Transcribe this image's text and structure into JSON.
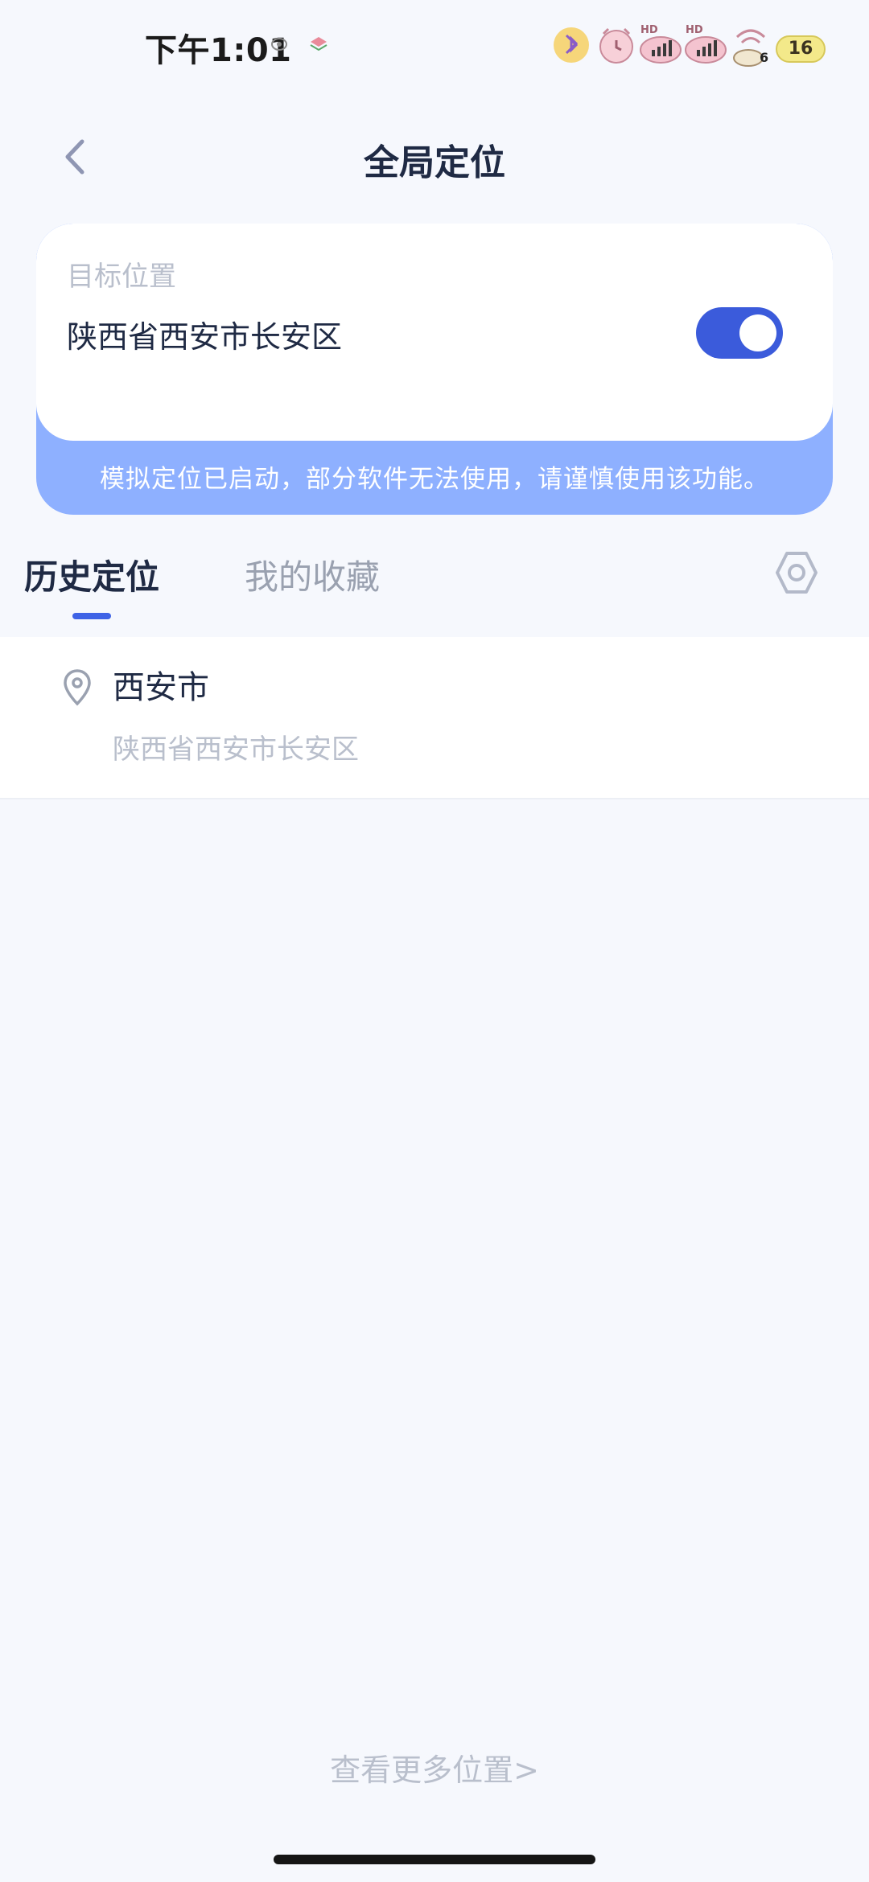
{
  "status_bar": {
    "time": "下午1:01",
    "signal_badge_1": "HD",
    "signal_badge_2": "HD",
    "wifi_sub": "6",
    "battery": "16"
  },
  "header": {
    "title": "全局定位",
    "back_icon": "chevron-left-icon"
  },
  "location_card": {
    "label": "目标位置",
    "address": "陕西省西安市长安区",
    "mock_enabled": true,
    "warning": "模拟定位已启动，部分软件无法使用，请谨慎使用该功能。"
  },
  "tabs": {
    "items": [
      {
        "label": "历史定位",
        "active": true
      },
      {
        "label": "我的收藏",
        "active": false
      }
    ],
    "settings_icon": "hexagon-settings-icon"
  },
  "history": {
    "items": [
      {
        "title": "西安市",
        "subtitle": "陕西省西安市长安区",
        "icon": "map-pin-icon"
      }
    ]
  },
  "footer": {
    "more_link": "查看更多位置>"
  },
  "colors": {
    "accent": "#3b5bdb",
    "banner": "#8eb0ff",
    "background": "#f6f8fd",
    "muted_text": "#b9bfcc"
  }
}
